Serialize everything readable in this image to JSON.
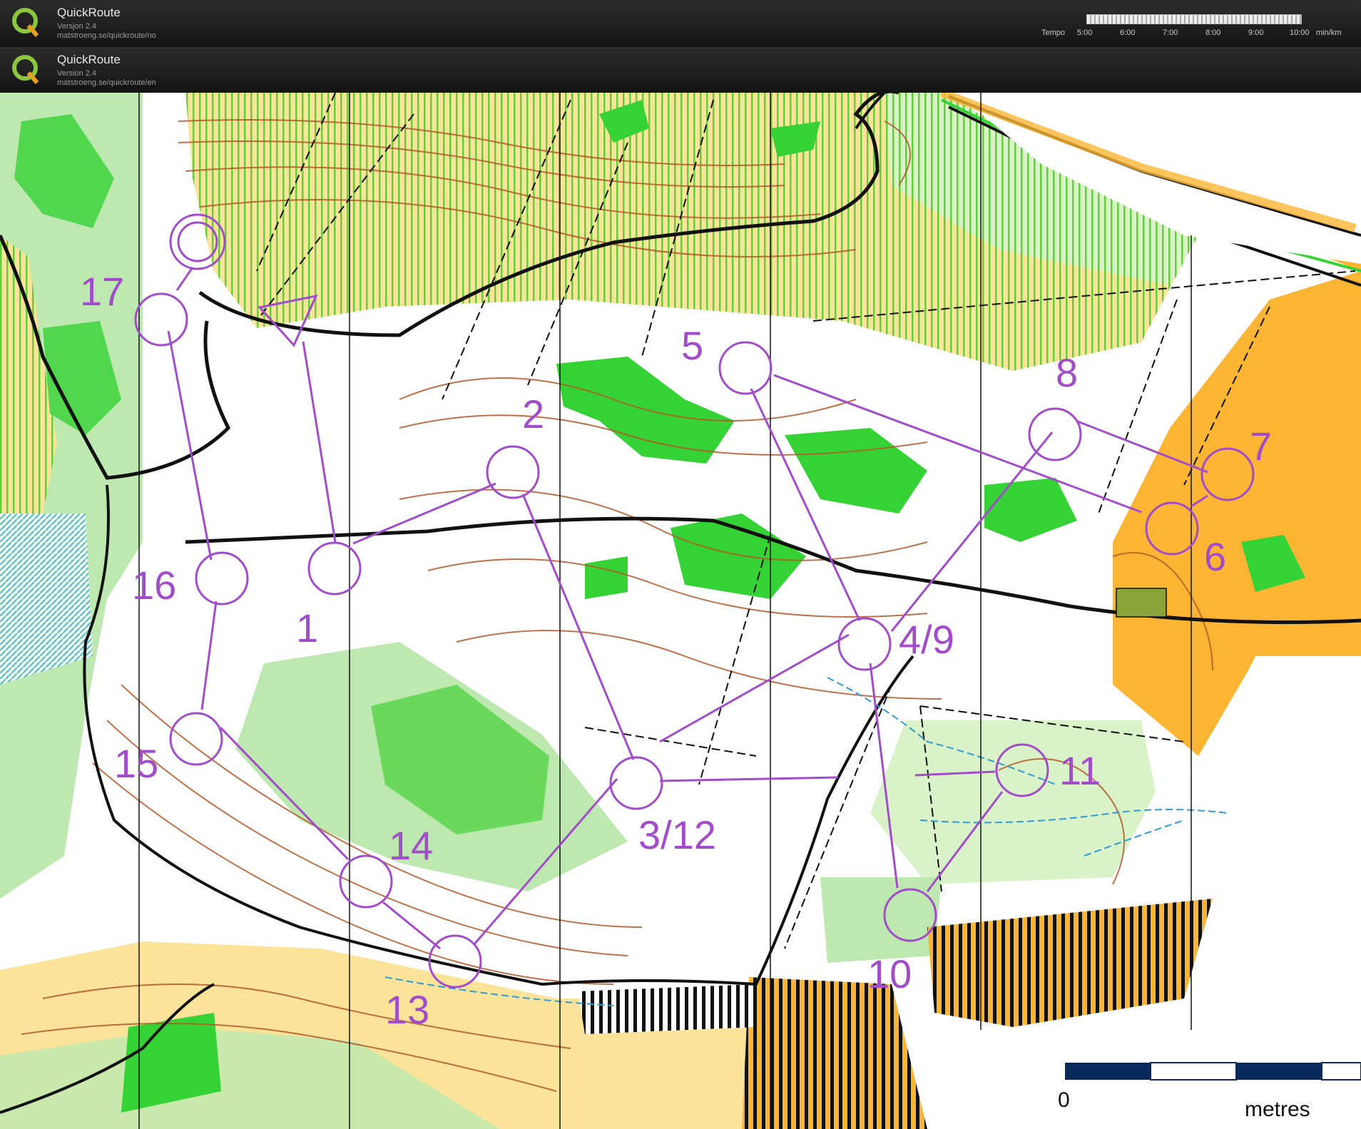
{
  "header_no": {
    "title": "QuickRoute",
    "version": "Versjon 2.4",
    "url": "matstroeng.se/quickroute/no"
  },
  "header_en": {
    "title": "QuickRoute",
    "version": "Version 2.4",
    "url": "matstroeng.se/quickroute/en"
  },
  "tempo": {
    "label": "Tempo",
    "ticks": [
      "5:00",
      "6:00",
      "7:00",
      "8:00",
      "9:00",
      "10:00"
    ],
    "unit": "min/km"
  },
  "controls": [
    {
      "label": "1"
    },
    {
      "label": "2"
    },
    {
      "label": "3/12"
    },
    {
      "label": "4/9"
    },
    {
      "label": "5"
    },
    {
      "label": "6"
    },
    {
      "label": "7"
    },
    {
      "label": "8"
    },
    {
      "label": "10"
    },
    {
      "label": "11"
    },
    {
      "label": "13"
    },
    {
      "label": "14"
    },
    {
      "label": "15"
    },
    {
      "label": "16"
    },
    {
      "label": "17"
    }
  ],
  "scale_bar": {
    "zero": "0",
    "unit": "metres"
  },
  "colors": {
    "course": "#a24ccc",
    "open_land": "#fbe399",
    "vegetation": "#35d235",
    "light_green": "#bde9b0",
    "rough_open": "#fbb533",
    "contour": "#b3582a",
    "water": "#2d9cd6"
  }
}
